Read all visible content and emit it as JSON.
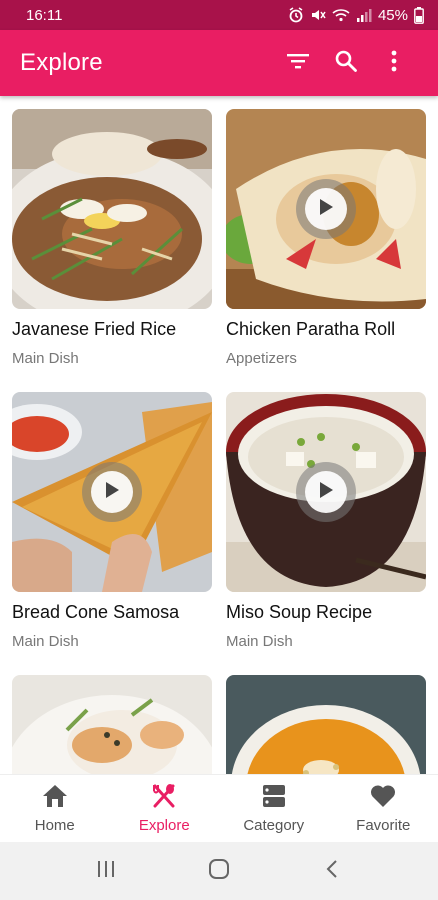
{
  "status_bar": {
    "time": "16:11",
    "battery": "45%"
  },
  "app_bar": {
    "title": "Explore"
  },
  "recipes": [
    {
      "title": "Javanese Fried Rice",
      "category": "Main Dish",
      "has_video": false
    },
    {
      "title": "Chicken Paratha Roll",
      "category": "Appetizers",
      "has_video": true
    },
    {
      "title": "Bread Cone Samosa",
      "category": "Main Dish",
      "has_video": true
    },
    {
      "title": "Miso Soup Recipe",
      "category": "Main Dish",
      "has_video": true
    },
    {
      "title": "",
      "category": "",
      "has_video": false
    },
    {
      "title": "",
      "category": "",
      "has_video": false
    }
  ],
  "bottom_nav": {
    "items": [
      {
        "label": "Home",
        "icon": "home-icon"
      },
      {
        "label": "Explore",
        "icon": "fork-knife-icon",
        "active": true
      },
      {
        "label": "Category",
        "icon": "category-icon"
      },
      {
        "label": "Favorite",
        "icon": "heart-icon"
      }
    ]
  },
  "colors": {
    "accent": "#e91e63",
    "status_bar": "#a8124a"
  }
}
